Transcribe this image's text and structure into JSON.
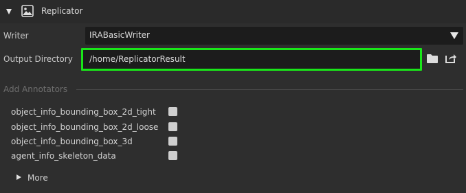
{
  "panel": {
    "title": "Replicator",
    "icon": "image-icon",
    "collapse_icon": "triangle-down-icon"
  },
  "writer": {
    "label": "Writer",
    "selected": "IRABasicWriter",
    "dropdown_icon": "triangle-down-icon"
  },
  "output_directory": {
    "label": "Output Directory",
    "value": "/home/ReplicatorResult",
    "highlight_color": "#19e619",
    "folder_icon": "folder-icon",
    "open_icon": "open-external-icon"
  },
  "annotators": {
    "section_label": "Add Annotators",
    "items": [
      {
        "label": "object_info_bounding_box_2d_tight",
        "checked": false
      },
      {
        "label": "object_info_bounding_box_2d_loose",
        "checked": false
      },
      {
        "label": "object_info_bounding_box_3d",
        "checked": false
      },
      {
        "label": "agent_info_skeleton_data",
        "checked": false
      }
    ]
  },
  "more": {
    "label": "More",
    "icon": "triangle-right-icon"
  }
}
